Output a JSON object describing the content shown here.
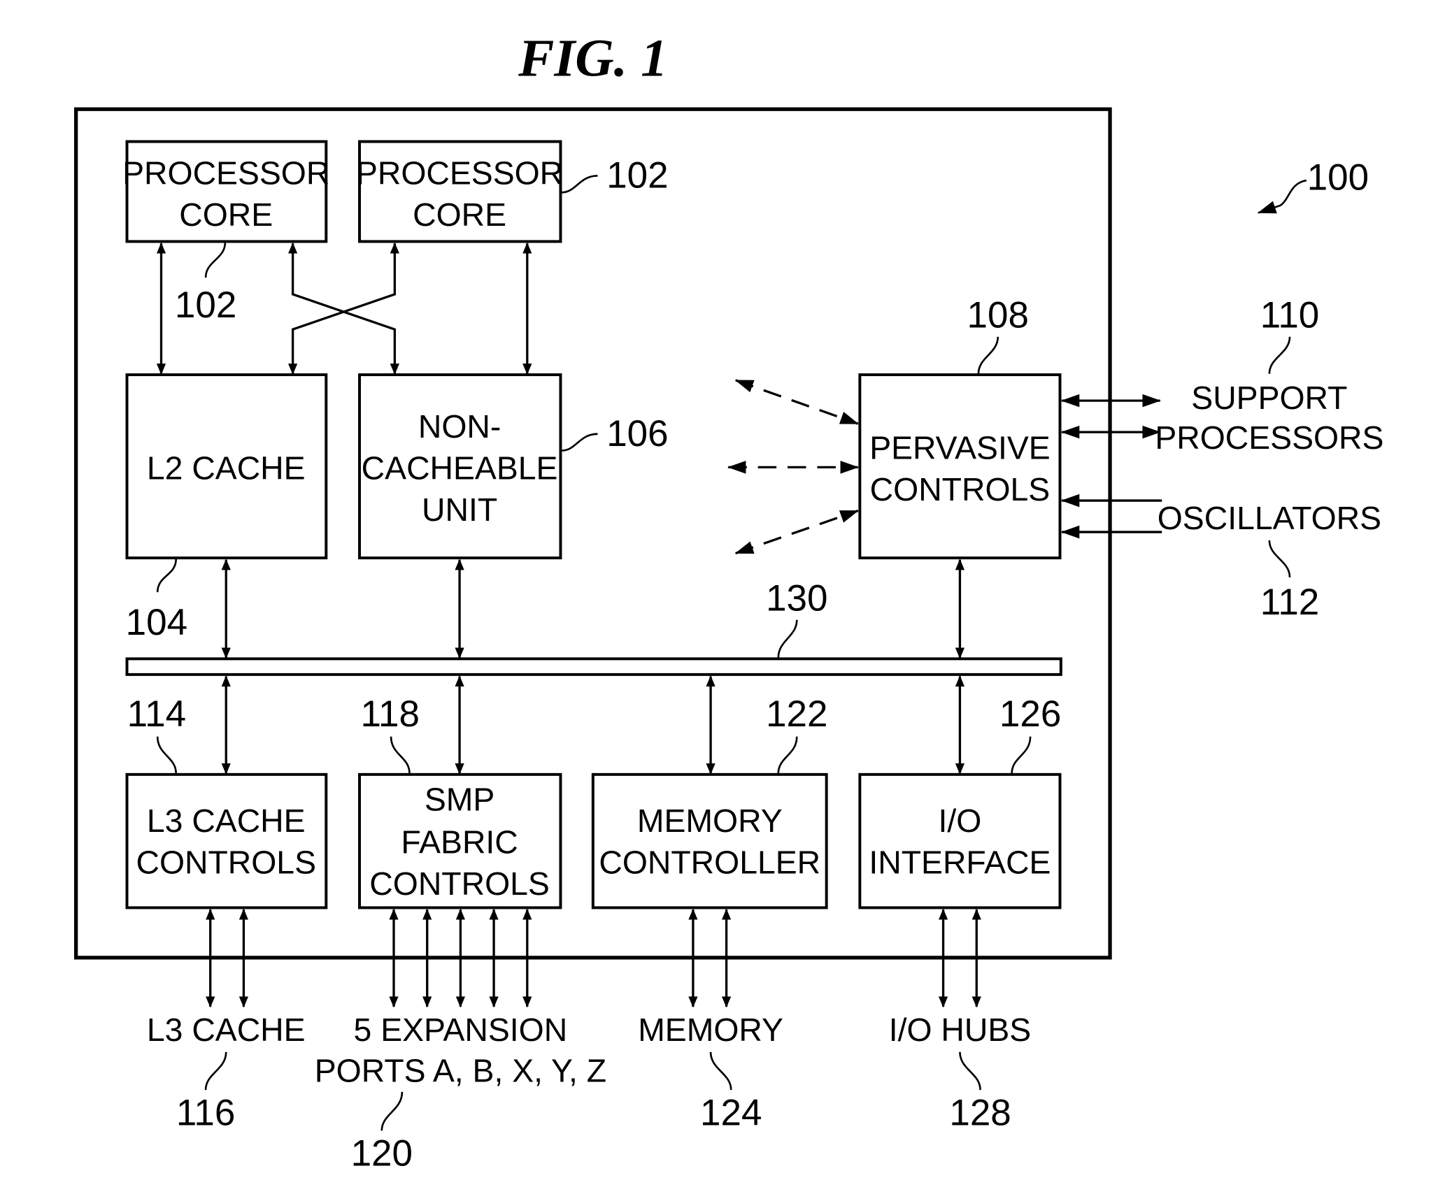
{
  "figure": {
    "title": "FIG. 1",
    "system_ref": "100"
  },
  "blocks": {
    "core_left": {
      "lines": [
        "PROCESSOR",
        "CORE"
      ],
      "ref": "102"
    },
    "core_right": {
      "lines": [
        "PROCESSOR",
        "CORE"
      ],
      "ref": "102"
    },
    "l2_cache": {
      "lines": [
        "L2 CACHE"
      ],
      "ref": "104"
    },
    "ncu": {
      "lines": [
        "NON-",
        "CACHEABLE",
        "UNIT"
      ],
      "ref": "106"
    },
    "pervasive": {
      "lines": [
        "PERVASIVE",
        "CONTROLS"
      ],
      "ref": "108"
    },
    "bus": {
      "ref": "130"
    },
    "l3_controls": {
      "lines": [
        "L3 CACHE",
        "CONTROLS"
      ],
      "ref": "114"
    },
    "smp_fabric": {
      "lines": [
        "SMP",
        "FABRIC",
        "CONTROLS"
      ],
      "ref": "118"
    },
    "mem_ctrl": {
      "lines": [
        "MEMORY",
        "CONTROLLER"
      ],
      "ref": "122"
    },
    "io_iface": {
      "lines": [
        "I/O",
        "INTERFACE"
      ],
      "ref": "126"
    }
  },
  "external": {
    "support_processors": {
      "lines": [
        "SUPPORT",
        "PROCESSORS"
      ],
      "ref": "110"
    },
    "oscillators": {
      "lines": [
        "OSCILLATORS"
      ],
      "ref": "112"
    },
    "l3_cache": {
      "lines": [
        "L3 CACHE"
      ],
      "ref": "116"
    },
    "expansion_ports": {
      "lines": [
        "5 EXPANSION",
        "PORTS A, B, X, Y, Z"
      ],
      "ref": "120"
    },
    "memory": {
      "lines": [
        "MEMORY"
      ],
      "ref": "124"
    },
    "io_hubs": {
      "lines": [
        "I/O HUBS"
      ],
      "ref": "128"
    }
  }
}
